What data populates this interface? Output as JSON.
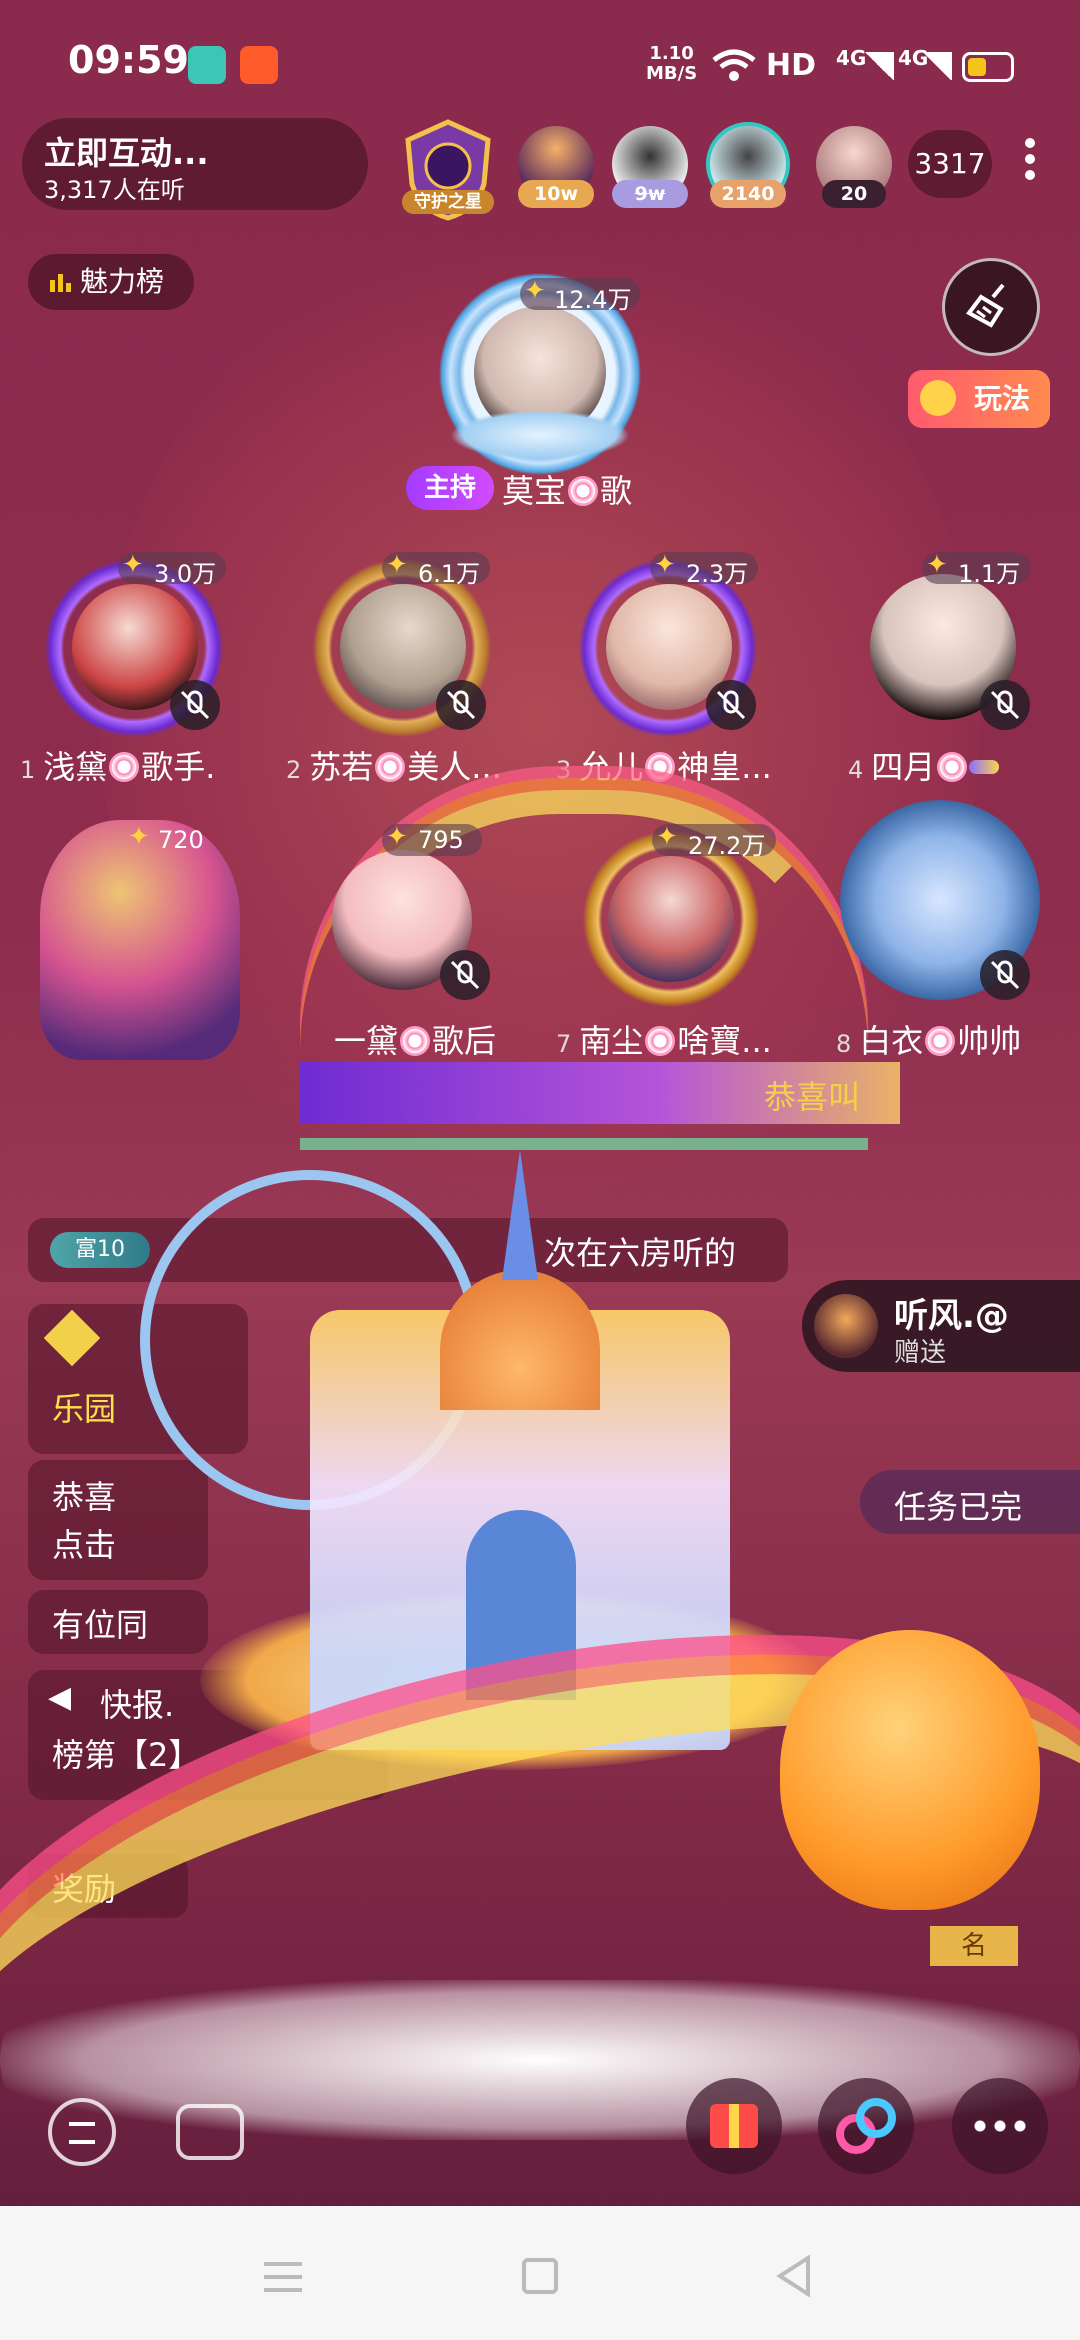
{
  "status_bar": {
    "time": "09:59",
    "net_speed": "1.10",
    "net_unit": "MB/S",
    "hd": "HD",
    "sig1": "4G",
    "sig2": "4G"
  },
  "room": {
    "title": "立即互动...",
    "listeners": "3,317人在听",
    "guard_label": "守护之星",
    "online_count": "3317"
  },
  "top_fans": [
    {
      "badge": "10w"
    },
    {
      "badge": "9w"
    },
    {
      "badge": "2140"
    },
    {
      "badge": "20"
    }
  ],
  "charm_board": {
    "label": "魅力榜"
  },
  "play": {
    "label": "玩法"
  },
  "host": {
    "score": "12.4万",
    "tag": "主持",
    "name": "莫宝",
    "suffix": "歌"
  },
  "seats": [
    {
      "num": "1",
      "name": "浅黛",
      "suffix": "歌手.",
      "score": "3.0万"
    },
    {
      "num": "2",
      "name": "苏若",
      "suffix": "美人...",
      "score": "6.1万"
    },
    {
      "num": "3",
      "name": "允儿",
      "suffix": "神皇...",
      "score": "2.3万"
    },
    {
      "num": "4",
      "name": "四月",
      "suffix": "",
      "score": "1.1万"
    },
    {
      "num": "",
      "name": "一黛",
      "suffix": "歌后",
      "score": "720"
    },
    {
      "num": "",
      "name": "",
      "suffix": "",
      "score": "795"
    },
    {
      "num": "7",
      "name": "南尘",
      "suffix": "啥寶...",
      "score": "27.2万"
    },
    {
      "num": "8",
      "name": "白衣",
      "suffix": "帅帅",
      "score": ""
    }
  ],
  "banner": {
    "text": "恭喜叫"
  },
  "chat": [
    {
      "level": "富10",
      "text": "次在六房听的"
    },
    {
      "text": "乐园"
    },
    {
      "text": "恭喜"
    },
    {
      "text": "点击"
    },
    {
      "text": "有位同"
    },
    {
      "text": "快报."
    },
    {
      "text": "榜第【2】"
    },
    {
      "text": "奖励"
    }
  ],
  "gift_notice": {
    "sender": "听风.@",
    "action": "赠送"
  },
  "task": {
    "text": "任务已完"
  },
  "rank_tag": {
    "text": "名"
  },
  "colors": {
    "accent": "#ff5b6e",
    "host_tag": "#b043ff",
    "bg": "#8a2a4c"
  }
}
